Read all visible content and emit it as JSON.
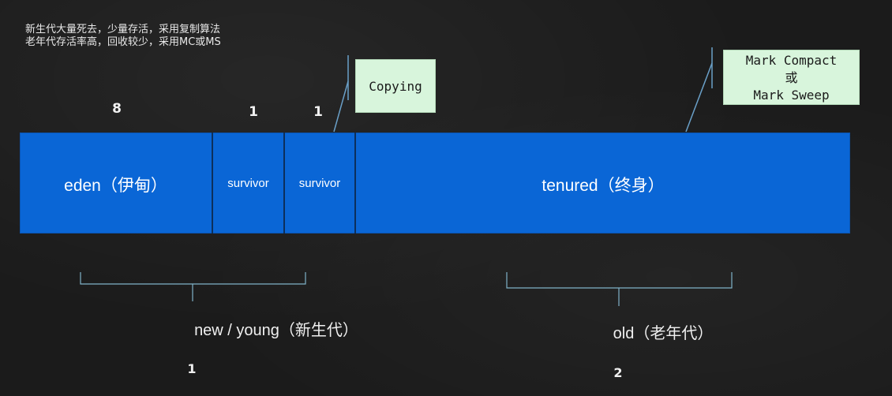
{
  "notes": {
    "line1": "新生代大量死去，少量存活，采用复制算法",
    "line2": "老年代存活率高，回收较少，采用MC或MS"
  },
  "ratios": {
    "eden": "8",
    "survivor1": "1",
    "survivor2": "1"
  },
  "segments": {
    "eden": "eden（伊甸）",
    "survivor1": "survivor",
    "survivor2": "survivor",
    "tenured": "tenured（终身）"
  },
  "callouts": {
    "copying": "Copying",
    "old_line1": "Mark Compact",
    "old_line2": "或",
    "old_line3": "Mark Sweep"
  },
  "groups": {
    "young_label": "new / young（新生代）",
    "young_num": "1",
    "old_label": "old（老年代）",
    "old_num": "2"
  },
  "colors": {
    "bar_fill": "#0a66d6",
    "callout_fill": "#d8f5dc",
    "brace": "#7fb2c8",
    "leader": "#6aa0c8"
  }
}
